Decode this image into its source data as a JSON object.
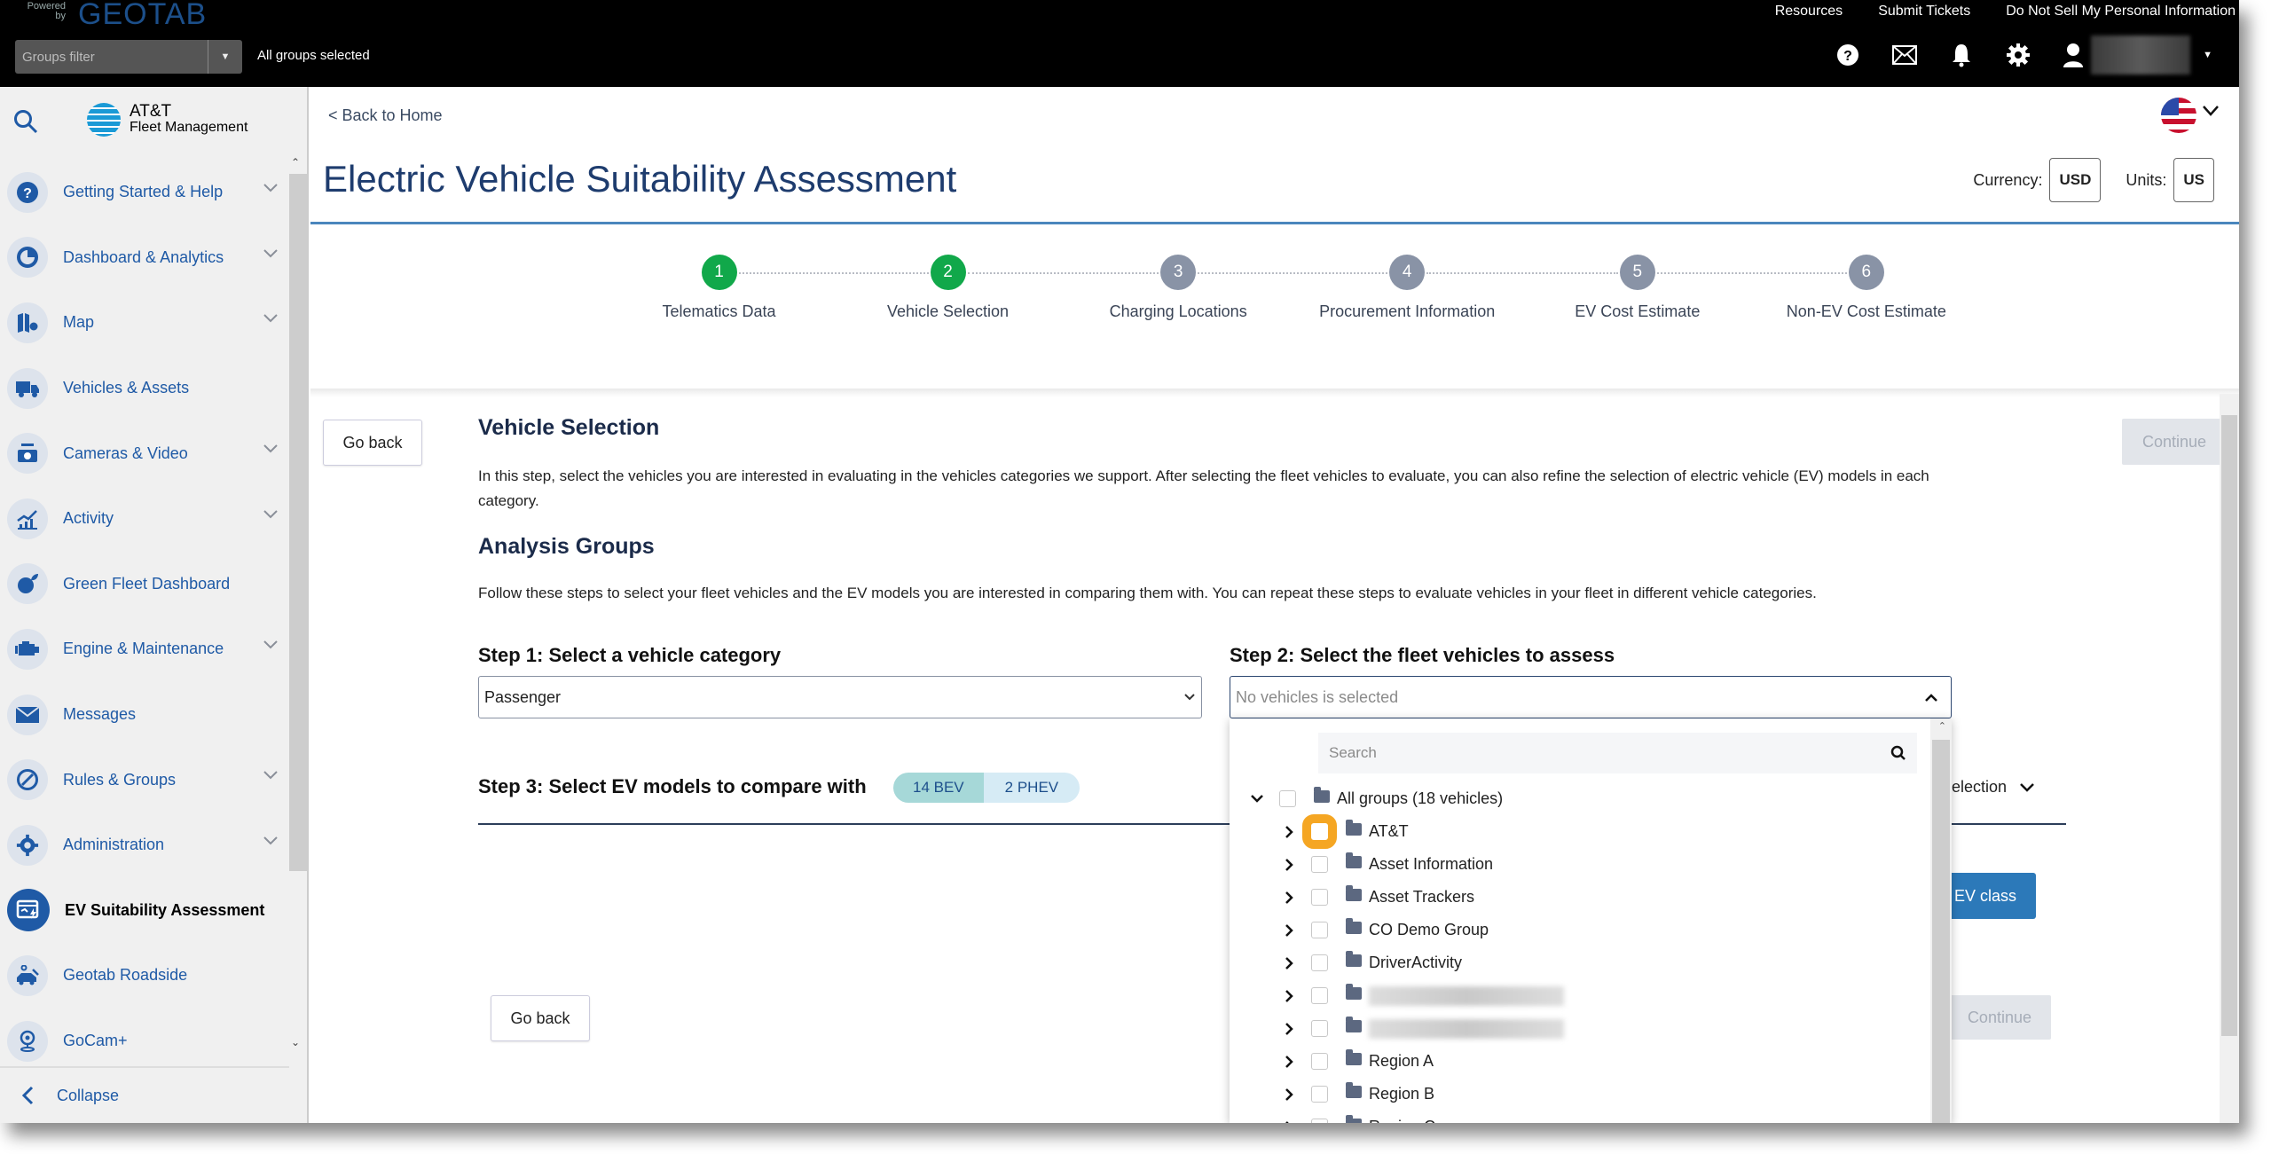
{
  "topbar": {
    "powered_by": "Powered by",
    "brand": "GEOTAB",
    "links": [
      "Resources",
      "Submit Tickets",
      "Do Not Sell My Personal Information"
    ],
    "groups_filter_placeholder": "Groups filter",
    "groups_status": "All groups selected",
    "icons": [
      "help-icon",
      "mail-icon",
      "bell-icon",
      "gear-icon",
      "user-icon"
    ]
  },
  "sidebar": {
    "logo_line1": "AT&T",
    "logo_line2": "Fleet Management",
    "items": [
      {
        "label": "Getting Started & Help",
        "icon": "help-circle-icon",
        "expandable": true
      },
      {
        "label": "Dashboard & Analytics",
        "icon": "pie-chart-icon",
        "expandable": true
      },
      {
        "label": "Map",
        "icon": "map-icon",
        "expandable": true
      },
      {
        "label": "Vehicles & Assets",
        "icon": "truck-icon",
        "expandable": false
      },
      {
        "label": "Cameras & Video",
        "icon": "camera-icon",
        "expandable": true
      },
      {
        "label": "Activity",
        "icon": "activity-chart-icon",
        "expandable": true
      },
      {
        "label": "Green Fleet Dashboard",
        "icon": "leaf-icon",
        "expandable": false
      },
      {
        "label": "Engine & Maintenance",
        "icon": "engine-icon",
        "expandable": true
      },
      {
        "label": "Messages",
        "icon": "envelope-icon",
        "expandable": false
      },
      {
        "label": "Rules & Groups",
        "icon": "rules-icon",
        "expandable": true
      },
      {
        "label": "Administration",
        "icon": "cog-icon",
        "expandable": true
      },
      {
        "label": "EV Suitability Assessment",
        "icon": "ev-assessment-icon",
        "expandable": false,
        "active": true
      },
      {
        "label": "Geotab Roadside",
        "icon": "roadside-icon",
        "expandable": false
      },
      {
        "label": "GoCam+",
        "icon": "gocam-icon",
        "expandable": false
      }
    ],
    "collapse_label": "Collapse"
  },
  "header": {
    "back_link": "< Back to Home",
    "title": "Electric Vehicle Suitability Assessment",
    "currency_label": "Currency:",
    "currency_value": "USD",
    "units_label": "Units:",
    "units_value": "US",
    "locale_flag": "us-flag-icon"
  },
  "stepper": {
    "steps": [
      {
        "num": "1",
        "label": "Telematics Data",
        "status": "done"
      },
      {
        "num": "2",
        "label": "Vehicle Selection",
        "status": "done"
      },
      {
        "num": "3",
        "label": "Charging Locations",
        "status": "todo"
      },
      {
        "num": "4",
        "label": "Procurement Information",
        "status": "todo"
      },
      {
        "num": "5",
        "label": "EV Cost Estimate",
        "status": "todo"
      },
      {
        "num": "6",
        "label": "Non-EV Cost Estimate",
        "status": "todo"
      }
    ],
    "go_back": "Go back",
    "continue": "Continue"
  },
  "section": {
    "heading": "Vehicle Selection",
    "intro_line1": "In this step, select the vehicles you are interested in evaluating in the vehicles categories we support. After selecting the fleet vehicles to evaluate, you can also refine the selection of electric vehicle (EV) models in each",
    "intro_line2": "category.",
    "analysis_heading": "Analysis Groups",
    "analysis_text": "Follow these steps to select your fleet vehicles and the EV models you are interested in comparing them with. You can repeat these steps to evaluate vehicles in your fleet in different vehicle categories.",
    "step1_label": "Step 1: Select a vehicle category",
    "step1_value": "Passenger",
    "step2_label": "Step 2: Select the fleet vehicles to assess",
    "step2_placeholder": "No vehicles is selected",
    "step3_label": "Step 3: Select EV models to compare with",
    "bev_badge": "14 BEV",
    "phev_badge": "2 PHEV",
    "selection_trunc": "election",
    "ev_class_button": "EV class",
    "go_back": "Go back",
    "continue": "Continue"
  },
  "dropdown": {
    "search_placeholder": "Search",
    "root": {
      "label": "All groups (18 vehicles)",
      "expanded": true,
      "checked": false
    },
    "children": [
      {
        "label": "AT&T",
        "focused": true
      },
      {
        "label": "Asset Information"
      },
      {
        "label": "Asset Trackers"
      },
      {
        "label": "CO Demo Group"
      },
      {
        "label": "DriverActivity"
      },
      {
        "label": "",
        "redacted": true
      },
      {
        "label": "",
        "redacted": true
      },
      {
        "label": "Region A"
      },
      {
        "label": "Region B"
      },
      {
        "label": "Region C"
      }
    ]
  }
}
